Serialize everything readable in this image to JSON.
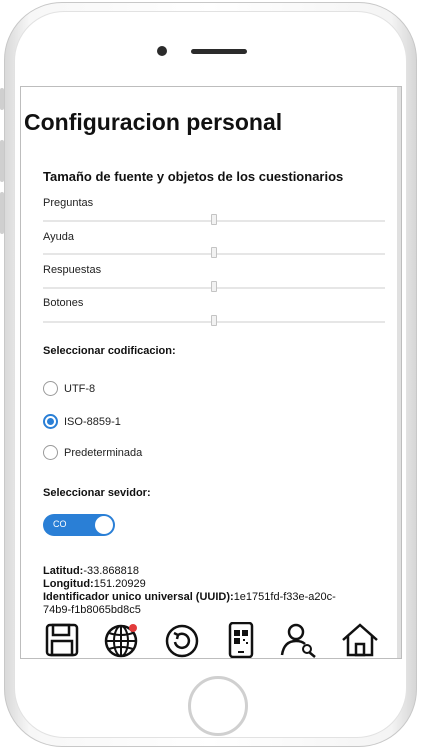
{
  "screen": {
    "title": "Configuracion personal",
    "font_section": {
      "heading": "Tamaño de fuente y objetos de los cuestionarios",
      "sliders": [
        {
          "label": "Preguntas"
        },
        {
          "label": "Ayuda"
        },
        {
          "label": "Respuestas"
        },
        {
          "label": "Botones"
        }
      ]
    },
    "encoding_section": {
      "heading": "Seleccionar codificacion:",
      "options": [
        "UTF-8",
        "ISO-8859-1",
        "Predeterminada"
      ],
      "selected": "ISO-8859-1"
    },
    "server_section": {
      "heading": "Seleccionar sevidor:",
      "toggle_label": "CO",
      "toggle_on": true
    },
    "info": {
      "latitude_label": "Latitud:",
      "latitude_value": "-33.868818",
      "longitude_label": "Longitud:",
      "longitude_value": "151.20929",
      "uuid_label": "Identificador unico universal (UUID):",
      "uuid_value_line1": "1e1751fd-f33e-a20c-",
      "uuid_value_line2": "74b9-f1b8065bd8c5"
    },
    "toolbar": {
      "icons": [
        "save-icon",
        "globe-icon",
        "refresh-icon",
        "qr-phone-icon",
        "user-key-icon",
        "home-icon"
      ],
      "globe_badge_color": "#e23b3b"
    },
    "colors": {
      "accent": "#2a7fd6"
    }
  }
}
